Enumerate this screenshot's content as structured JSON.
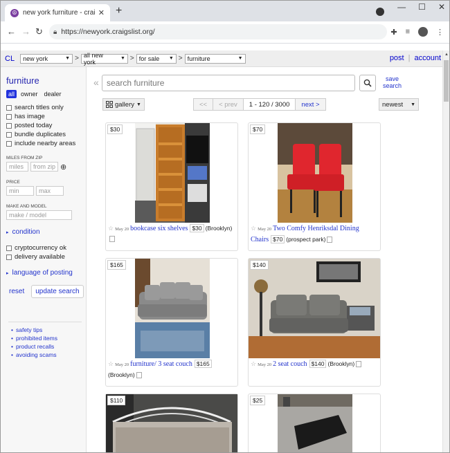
{
  "browser": {
    "tab_title": "new york furniture - craigslist",
    "url": "https://newyork.craigslist.org/",
    "newtab": "+"
  },
  "header": {
    "logo": "CL",
    "crumbs": [
      "new york",
      "all new york",
      "for sale",
      "furniture"
    ],
    "post": "post",
    "account": "account"
  },
  "sidebar": {
    "title": "furniture",
    "seller_seg": [
      "all",
      "owner",
      "dealer"
    ],
    "checks": [
      "search titles only",
      "has image",
      "posted today",
      "bundle duplicates",
      "include nearby areas"
    ],
    "miles_label": "MILES FROM ZIP",
    "miles_placeholder": "miles",
    "zip_placeholder": "from zip",
    "price_label": "PRICE",
    "min_placeholder": "min",
    "max_placeholder": "max",
    "make_label": "MAKE AND MODEL",
    "make_placeholder": "make / model",
    "condition": "condition",
    "checks2": [
      "cryptocurrency ok",
      "delivery available"
    ],
    "language": "language of posting",
    "reset": "reset",
    "update": "update search",
    "help_links": [
      "safety tips",
      "prohibited items",
      "product recalls",
      "avoiding scams"
    ]
  },
  "main": {
    "search_placeholder": "search furniture",
    "save": "save",
    "search_label": "search",
    "view": "gallery",
    "pager": {
      "first": "<<",
      "prev": "< prev",
      "range": "1 - 120 / 3000",
      "next": "next >"
    },
    "sort": "newest"
  },
  "listings": [
    {
      "price": "$30",
      "date": "May 20",
      "title": "bookcase six shelves",
      "price_badge": "$30",
      "location": "(Brooklyn)"
    },
    {
      "price": "$70",
      "date": "May 20",
      "title": "Two Comfy Henriksdal Dining Chairs",
      "price_badge": "$70",
      "location": "(prospect park)"
    },
    {
      "price": "$165",
      "date": "May 20",
      "title": "furniture/ 3 seat couch",
      "price_badge": "$165",
      "location": "(Brooklyn)"
    },
    {
      "price": "$140",
      "date": "May 20",
      "title": "2 seat couch",
      "price_badge": "$140",
      "location": "(Brooklyn)"
    },
    {
      "price": "$110"
    },
    {
      "price": "$25"
    }
  ],
  "colors": {
    "link": "#2233cc",
    "accent": "#2233dd"
  }
}
